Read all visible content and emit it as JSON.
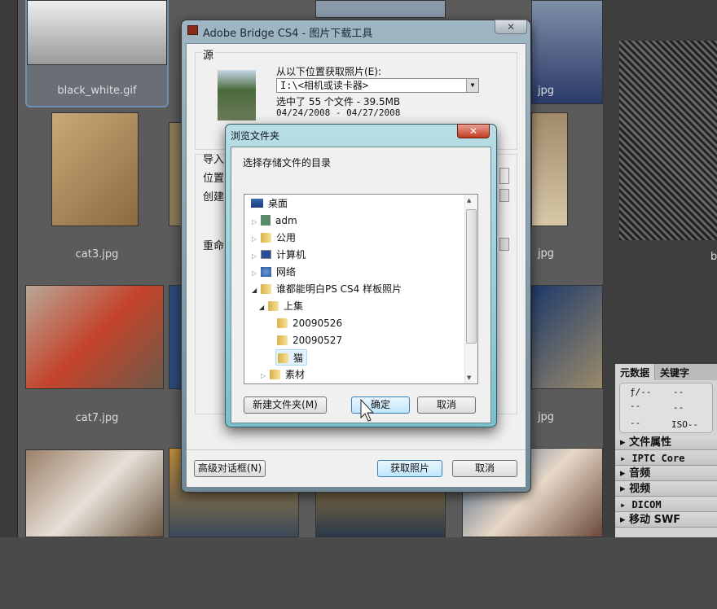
{
  "thumbnails": [
    {
      "label": "black_white.gif"
    },
    {
      "label": "cat3.jpg"
    },
    {
      "label": "cat7.jpg"
    },
    {
      "label": "jpg"
    },
    {
      "label": "jpg"
    },
    {
      "label": "jpg"
    }
  ],
  "right_panel": {
    "tabs": [
      "元数据",
      "关键字"
    ],
    "camera": {
      "aperture": "ƒ/--",
      "shutter": "--",
      "a": "--",
      "b": "--",
      "c": "--",
      "iso": "ISO--"
    },
    "sections": [
      "文件属性",
      "IPTC Core",
      "音频",
      "视频",
      "DICOM",
      "移动 SWF"
    ],
    "partial_label": "b"
  },
  "main_dialog": {
    "title": "Adobe Bridge CS4 - 图片下载工具",
    "source_label": "源",
    "get_from_label": "从以下位置获取照片(E):",
    "source_value": "I:\\<相机或读卡器>",
    "selected_info": "选中了 55 个文件 - 39.5MB",
    "date_range": "04/24/2008 - 04/27/2008",
    "partial_labels": [
      "导入",
      "位置",
      "创建",
      "重命"
    ],
    "advanced_button": "高级对话框(N)",
    "get_photos_button": "获取照片",
    "cancel_button": "取消"
  },
  "browse_dialog": {
    "title": "浏览文件夹",
    "prompt": "选择存储文件的目录",
    "tree": [
      {
        "label": "桌面"
      },
      {
        "label": "adm"
      },
      {
        "label": "公用"
      },
      {
        "label": "计算机"
      },
      {
        "label": "网络"
      },
      {
        "label": "谁都能明白PS CS4 样板照片"
      },
      {
        "label": "上集"
      },
      {
        "label": "20090526"
      },
      {
        "label": "20090527"
      },
      {
        "label": "猫",
        "selected": true
      },
      {
        "label": "素材"
      }
    ],
    "new_folder_button": "新建文件夹(M)",
    "ok_button": "确定",
    "cancel_button": "取消"
  }
}
